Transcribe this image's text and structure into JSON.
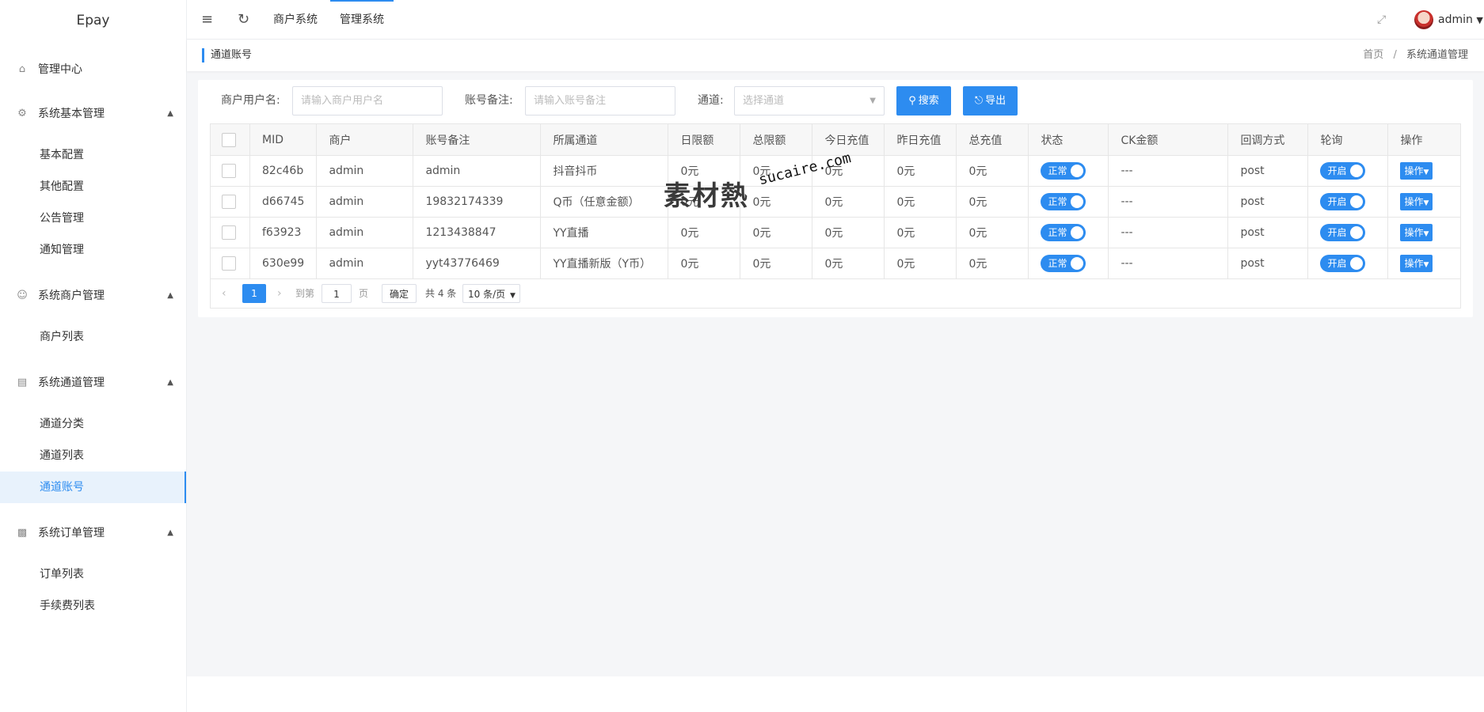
{
  "app": {
    "title": "Epay"
  },
  "sidebar": {
    "home": "管理中心",
    "groups": [
      {
        "label": "系统基本管理",
        "items": [
          "基本配置",
          "其他配置",
          "公告管理",
          "通知管理"
        ]
      },
      {
        "label": "系统商户管理",
        "items": [
          "商户列表"
        ]
      },
      {
        "label": "系统通道管理",
        "items": [
          "通道分类",
          "通道列表",
          "通道账号"
        ]
      },
      {
        "label": "系统订单管理",
        "items": [
          "订单列表",
          "手续费列表"
        ]
      }
    ],
    "active_item": "通道账号"
  },
  "header": {
    "tabs": [
      "商户系统",
      "管理系统"
    ],
    "active_tab": "管理系统",
    "user": "admin"
  },
  "breadcrumb": {
    "page_title": "通道账号",
    "home": "首页",
    "sep": "/",
    "current": "系统通道管理"
  },
  "filters": {
    "merchant_label": "商户用户名:",
    "merchant_placeholder": "请输入商户用户名",
    "remark_label": "账号备注:",
    "remark_placeholder": "请输入账号备注",
    "channel_label": "通道:",
    "channel_placeholder": "选择通道",
    "search_label": "搜索",
    "export_label": "导出"
  },
  "table": {
    "columns": [
      "MID",
      "商户",
      "账号备注",
      "所属通道",
      "日限额",
      "总限额",
      "今日充值",
      "昨日充值",
      "总充值",
      "状态",
      "CK金额",
      "回调方式",
      "轮询",
      "操作"
    ],
    "rows": [
      {
        "mid": "82c46b",
        "merchant": "admin",
        "remark": "admin",
        "channel": "抖音抖币",
        "day_limit": "0元",
        "total_limit": "0元",
        "today": "0元",
        "yesterday": "0元",
        "total": "0元",
        "status": "正常",
        "ck": "---",
        "callback": "post",
        "poll": "开启",
        "op": "操作"
      },
      {
        "mid": "d66745",
        "merchant": "admin",
        "remark": "19832174339",
        "channel": "Q币（任意金额）",
        "day_limit": "0元",
        "total_limit": "0元",
        "today": "0元",
        "yesterday": "0元",
        "total": "0元",
        "status": "正常",
        "ck": "---",
        "callback": "post",
        "poll": "开启",
        "op": "操作"
      },
      {
        "mid": "f63923",
        "merchant": "admin",
        "remark": "1213438847",
        "channel": "YY直播",
        "day_limit": "0元",
        "total_limit": "0元",
        "today": "0元",
        "yesterday": "0元",
        "total": "0元",
        "status": "正常",
        "ck": "---",
        "callback": "post",
        "poll": "开启",
        "op": "操作"
      },
      {
        "mid": "630e99",
        "merchant": "admin",
        "remark": "yyt43776469",
        "channel": "YY直播新版（Y币）",
        "day_limit": "0元",
        "total_limit": "0元",
        "today": "0元",
        "yesterday": "0元",
        "total": "0元",
        "status": "正常",
        "ck": "---",
        "callback": "post",
        "poll": "开启",
        "op": "操作"
      }
    ]
  },
  "pagination": {
    "current_page": "1",
    "goto_label": "到第",
    "goto_value": "1",
    "page_unit": "页",
    "confirm": "确定",
    "total": "共 4 条",
    "page_size": "10 条/页"
  },
  "watermark": {
    "cn": "素材熱",
    "en": "sucaire.com"
  },
  "colors": {
    "accent": "#2d8cf0"
  }
}
